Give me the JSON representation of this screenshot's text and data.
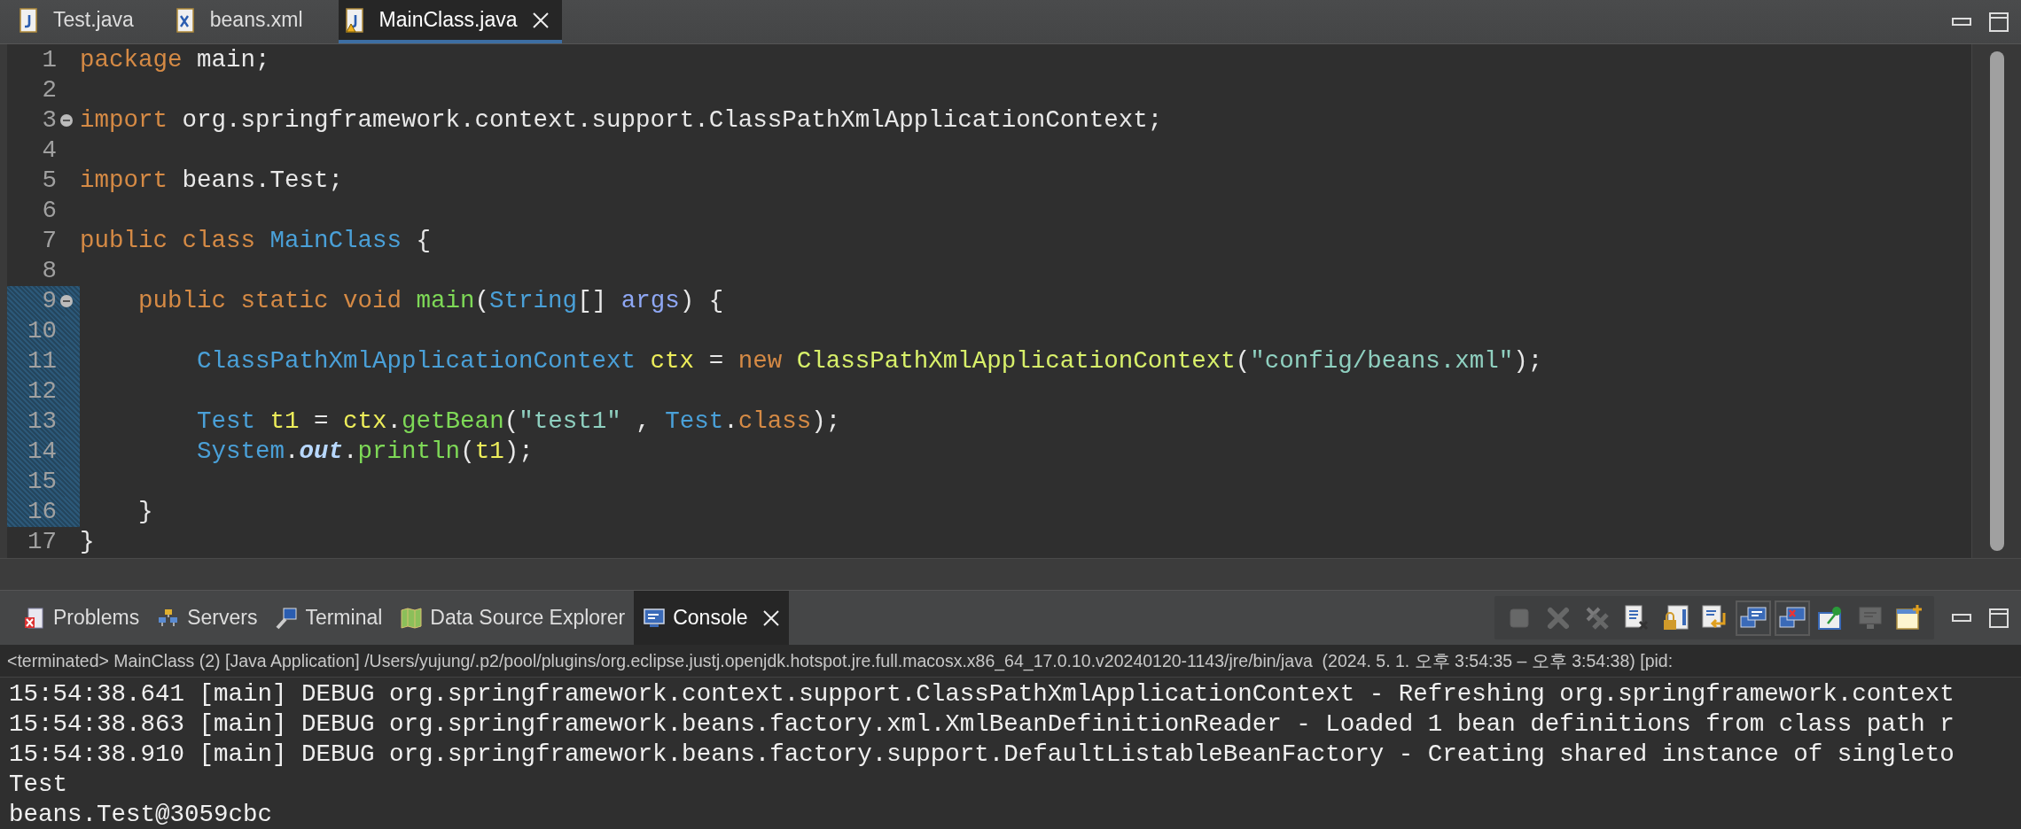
{
  "editor_tabs": [
    {
      "label": "Test.java",
      "kind": "java",
      "selected": false,
      "warning": false,
      "closable": false
    },
    {
      "label": "beans.xml",
      "kind": "xml",
      "selected": false,
      "warning": false,
      "closable": false
    },
    {
      "label": "MainClass.java",
      "kind": "java",
      "selected": true,
      "warning": true,
      "closable": true
    }
  ],
  "code_lines": [
    {
      "number": "1",
      "foldable": false,
      "modified": false,
      "tokens": [
        {
          "kind": "keyword",
          "text": "package"
        },
        {
          "kind": "plain",
          "text": " main;"
        }
      ]
    },
    {
      "number": "2",
      "foldable": false,
      "modified": false
    },
    {
      "number": "3",
      "foldable": true,
      "modified": false,
      "tokens": [
        {
          "kind": "keyword",
          "text": "import"
        },
        {
          "kind": "plain",
          "text": " org.springframework.context.support.ClassPathXmlApplicationContext;"
        }
      ]
    },
    {
      "number": "4",
      "foldable": false,
      "modified": false
    },
    {
      "number": "5",
      "foldable": false,
      "modified": false,
      "tokens": [
        {
          "kind": "keyword",
          "text": "import"
        },
        {
          "kind": "plain",
          "text": " beans.Test;"
        }
      ]
    },
    {
      "number": "6",
      "foldable": false,
      "modified": false
    },
    {
      "number": "7",
      "foldable": false,
      "modified": false,
      "tokens": [
        {
          "kind": "keyword",
          "text": "public class "
        },
        {
          "kind": "type",
          "text": "MainClass"
        },
        {
          "kind": "plain",
          "text": " {"
        }
      ]
    },
    {
      "number": "8",
      "foldable": false,
      "modified": false
    },
    {
      "number": "9",
      "foldable": true,
      "modified": true,
      "tokens": [
        {
          "kind": "keyword",
          "text": "    public static void "
        },
        {
          "kind": "method",
          "text": "main"
        },
        {
          "kind": "plain",
          "text": "("
        },
        {
          "kind": "type",
          "text": "String"
        },
        {
          "kind": "plain",
          "text": "[] "
        },
        {
          "kind": "param",
          "text": "args"
        },
        {
          "kind": "plain",
          "text": ") {"
        }
      ]
    },
    {
      "number": "10",
      "foldable": false,
      "modified": true
    },
    {
      "number": "11",
      "foldable": false,
      "modified": true,
      "tokens": [
        {
          "kind": "type",
          "text": "        ClassPathXmlApplicationContext "
        },
        {
          "kind": "local",
          "text": "ctx"
        },
        {
          "kind": "plain",
          "text": " = "
        },
        {
          "kind": "keyword",
          "text": "new "
        },
        {
          "kind": "constructor",
          "text": "ClassPathXmlApplicationContext"
        },
        {
          "kind": "plain",
          "text": "("
        },
        {
          "kind": "string",
          "text": "\"config/beans.xml\""
        },
        {
          "kind": "plain",
          "text": ");"
        }
      ]
    },
    {
      "number": "12",
      "foldable": false,
      "modified": true
    },
    {
      "number": "13",
      "foldable": false,
      "modified": true,
      "tokens": [
        {
          "kind": "type",
          "text": "        Test "
        },
        {
          "kind": "local",
          "text": "t1"
        },
        {
          "kind": "plain",
          "text": " = "
        },
        {
          "kind": "local",
          "text": "ctx"
        },
        {
          "kind": "plain",
          "text": "."
        },
        {
          "kind": "method",
          "text": "getBean"
        },
        {
          "kind": "plain",
          "text": "("
        },
        {
          "kind": "string",
          "text": "\"test1\""
        },
        {
          "kind": "plain",
          "text": " , "
        },
        {
          "kind": "type",
          "text": "Test"
        },
        {
          "kind": "plain",
          "text": "."
        },
        {
          "kind": "keyword",
          "text": "class"
        },
        {
          "kind": "plain",
          "text": ");"
        }
      ]
    },
    {
      "number": "14",
      "foldable": false,
      "modified": true,
      "tokens": [
        {
          "kind": "type",
          "text": "        System"
        },
        {
          "kind": "plain",
          "text": "."
        },
        {
          "kind": "field",
          "text": "out"
        },
        {
          "kind": "plain",
          "text": "."
        },
        {
          "kind": "method",
          "text": "println"
        },
        {
          "kind": "plain",
          "text": "("
        },
        {
          "kind": "local",
          "text": "t1"
        },
        {
          "kind": "plain",
          "text": ");"
        }
      ]
    },
    {
      "number": "15",
      "foldable": false,
      "modified": true
    },
    {
      "number": "16",
      "foldable": false,
      "modified": true,
      "tokens": [
        {
          "kind": "plain",
          "text": "    }"
        }
      ]
    },
    {
      "number": "17",
      "foldable": false,
      "modified": false,
      "tokens": [
        {
          "kind": "plain",
          "text": "}"
        }
      ]
    }
  ],
  "view_tabs": [
    {
      "label": "Problems",
      "kind": "problems",
      "selected": false,
      "closable": false
    },
    {
      "label": "Servers",
      "kind": "servers",
      "selected": false,
      "closable": false
    },
    {
      "label": "Terminal",
      "kind": "terminal",
      "selected": false,
      "closable": false
    },
    {
      "label": "Data Source Explorer",
      "kind": "datasource",
      "selected": false,
      "closable": false
    },
    {
      "label": "Console",
      "kind": "console",
      "selected": true,
      "closable": true
    }
  ],
  "console_toolbar": [
    {
      "kind": "stop",
      "disabled": true,
      "pressed": false
    },
    {
      "kind": "remove",
      "disabled": true,
      "pressed": false
    },
    {
      "kind": "remove-all",
      "disabled": true,
      "pressed": false
    },
    {
      "kind": "clear",
      "disabled": false,
      "pressed": false
    },
    {
      "kind": "scroll-lock",
      "disabled": false,
      "pressed": false
    },
    {
      "kind": "word-wrap",
      "disabled": false,
      "pressed": false
    },
    {
      "kind": "show-on-out",
      "disabled": false,
      "pressed": true
    },
    {
      "kind": "show-on-err",
      "disabled": false,
      "pressed": true
    },
    {
      "kind": "pin",
      "disabled": false,
      "pressed": false
    },
    {
      "kind": "display",
      "disabled": true,
      "pressed": false
    },
    {
      "kind": "new-console",
      "disabled": false,
      "pressed": false
    }
  ],
  "console_header": "<terminated> MainClass (2) [Java Application] /Users/yujung/.p2/pool/plugins/org.eclipse.justj.openjdk.hotspot.jre.full.macosx.x86_64_17.0.10.v20240120-1143/jre/bin/java  (2024. 5. 1. 오후 3:54:35 – 오후 3:54:38) [pid:",
  "console_lines": [
    "15:54:38.641 [main] DEBUG org.springframework.context.support.ClassPathXmlApplicationContext - Refreshing org.springframework.context",
    "15:54:38.863 [main] DEBUG org.springframework.beans.factory.xml.XmlBeanDefinitionReader - Loaded 1 bean definitions from class path r",
    "15:54:38.910 [main] DEBUG org.springframework.beans.factory.support.DefaultListableBeanFactory - Creating shared instance of singleto",
    "Test",
    "beans.Test@3059cbc"
  ]
}
